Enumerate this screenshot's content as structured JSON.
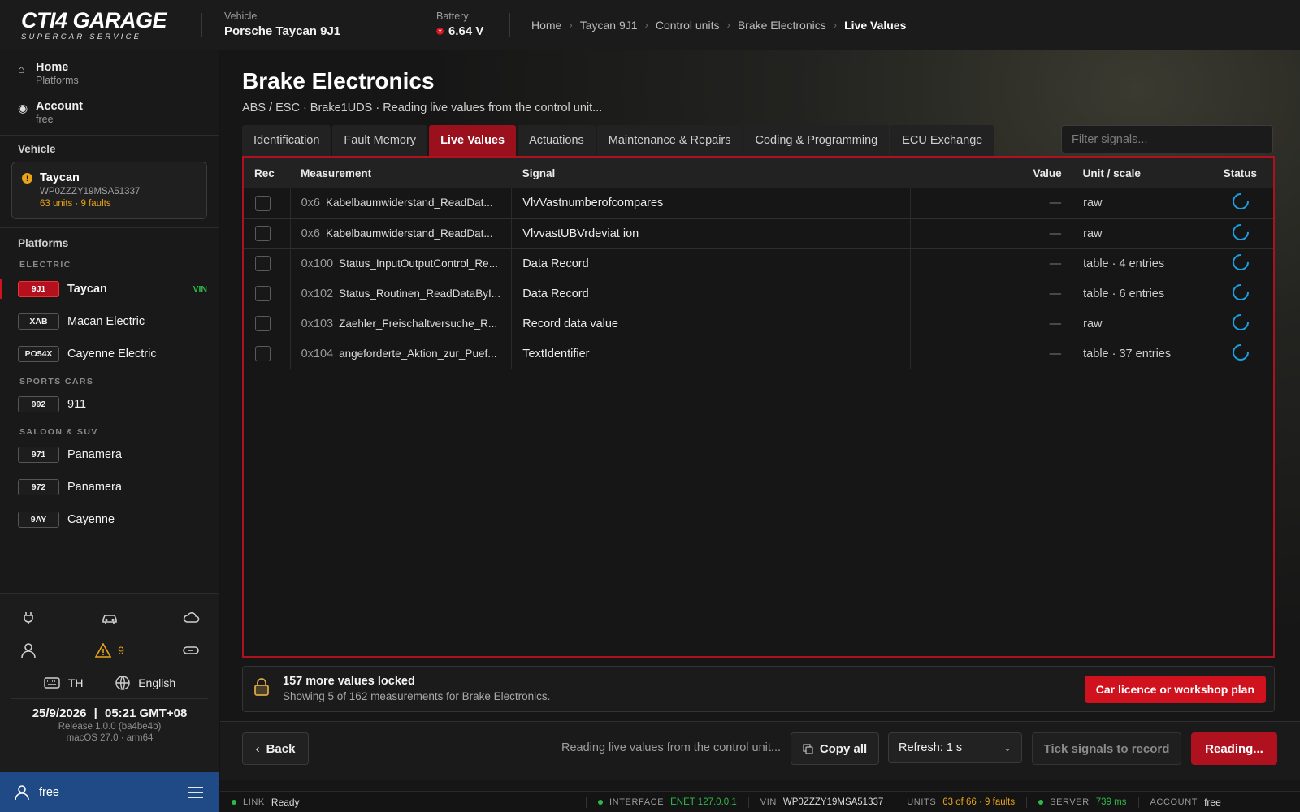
{
  "app": {
    "logo_main": "CTI4 GARAGE",
    "logo_sub": "SUPERCAR SERVICE"
  },
  "topbar": {
    "vehicle_label": "Vehicle",
    "vehicle_value": "Porsche Taycan 9J1",
    "battery_label": "Battery",
    "battery_value": "6.64 V",
    "breadcrumb": [
      "Home",
      "Taycan 9J1",
      "Control units",
      "Brake Electronics",
      "Live Values"
    ]
  },
  "sidebar": {
    "home_title": "Home",
    "home_sub": "Platforms",
    "account_title": "Account",
    "account_sub": "free",
    "vehicle_heading": "Vehicle",
    "vehicle_card": {
      "name": "Taycan",
      "vin": "WP0ZZZY19MSA51337",
      "units": "63 units · 9 faults"
    },
    "platforms_heading": "Platforms",
    "categories": [
      {
        "name": "ELECTRIC",
        "items": [
          {
            "code": "9J1",
            "name": "Taycan",
            "tag": "VIN",
            "active": true
          },
          {
            "code": "XAB",
            "name": "Macan Electric"
          },
          {
            "code": "PO54X",
            "name": "Cayenne Electric"
          }
        ]
      },
      {
        "name": "SPORTS CARS",
        "items": [
          {
            "code": "992",
            "name": "911"
          }
        ]
      },
      {
        "name": "SALOON & SUV",
        "items": [
          {
            "code": "971",
            "name": "Panamera"
          },
          {
            "code": "972",
            "name": "Panamera"
          },
          {
            "code": "9AY",
            "name": "Cayenne"
          }
        ]
      }
    ],
    "warning_count": "9",
    "keyboard_label": "TH",
    "language_label": "English",
    "date": "25/9/2026",
    "time": "05:21 GMT+08",
    "release": "Release 1.0.0 (ba4be4b)",
    "os": "macOS 27.0 · arm64",
    "user": "free"
  },
  "main": {
    "title": "Brake Electronics",
    "subtitle": "ABS / ESC · Brake1UDS · Reading live values from the control unit...",
    "tabs": [
      "Identification",
      "Fault Memory",
      "Live Values",
      "Actuations",
      "Maintenance & Repairs",
      "Coding & Programming",
      "ECU Exchange"
    ],
    "active_tab": 2,
    "filter_placeholder": "Filter signals...",
    "table": {
      "headers": {
        "rec": "Rec",
        "measurement": "Measurement",
        "signal": "Signal",
        "value": "Value",
        "unit": "Unit / scale",
        "status": "Status"
      },
      "rows": [
        {
          "hex": "0x6",
          "name": "Kabelbaumwiderstand_ReadDat...",
          "signal": "VlvVastnumberofcompares",
          "value": "—",
          "unit": "raw"
        },
        {
          "hex": "0x6",
          "name": "Kabelbaumwiderstand_ReadDat...",
          "signal": "VlvvastUBVrdeviat ion",
          "value": "—",
          "unit": "raw"
        },
        {
          "hex": "0x100",
          "name": "Status_InputOutputControl_Re...",
          "signal": "Data Record",
          "value": "—",
          "unit": "table · 4 entries"
        },
        {
          "hex": "0x102",
          "name": "Status_Routinen_ReadDataByI...",
          "signal": "Data Record",
          "value": "—",
          "unit": "table · 6 entries"
        },
        {
          "hex": "0x103",
          "name": "Zaehler_Freischaltversuche_R...",
          "signal": "Record data value",
          "value": "—",
          "unit": "raw"
        },
        {
          "hex": "0x104",
          "name": "angeforderte_Aktion_zur_Puef...",
          "signal": "TextIdentifier",
          "value": "—",
          "unit": "table · 37 entries"
        }
      ]
    },
    "locked": {
      "title": "157 more values locked",
      "sub": "Showing 5 of 162 measurements for Brake Electronics.",
      "button": "Car licence or workshop plan"
    },
    "actions": {
      "back": "Back",
      "reading_text": "Reading live values from the control unit...",
      "copy": "Copy all",
      "refresh": "Refresh: 1 s",
      "tick": "Tick signals to record",
      "reading_button": "Reading..."
    },
    "statusbar": {
      "link_label": "LINK",
      "link_value": "Ready",
      "interface_label": "INTERFACE",
      "interface_value": "ENET 127.0.0.1",
      "vin_label": "VIN",
      "vin_value": "WP0ZZZY19MSA51337",
      "units_label": "UNITS",
      "units_value": "63 of 66 · 9 faults",
      "server_label": "SERVER",
      "server_value": "739 ms",
      "account_label": "ACCOUNT",
      "account_value": "free"
    }
  },
  "colors": {
    "accent": "#b0111f",
    "active_tab": "#9b101d",
    "ok": "#2fb84a",
    "warning": "#e8a319",
    "spinner": "#1a9fe0",
    "user_bar": "#1f4a86"
  }
}
